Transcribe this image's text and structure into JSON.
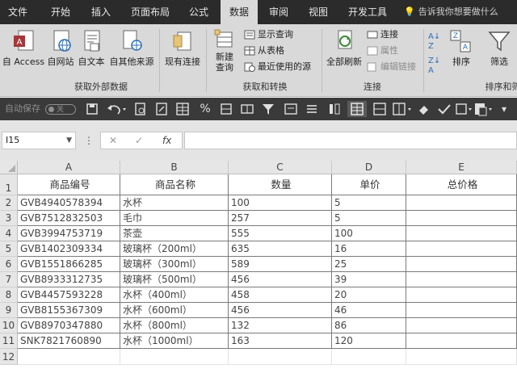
{
  "tabs": [
    "文件",
    "开始",
    "插入",
    "页面布局",
    "公式",
    "数据",
    "审阅",
    "视图",
    "开发工具"
  ],
  "active_tab": "数据",
  "tell_me": "告诉我你想要做什么",
  "ribbon": {
    "get_external": {
      "label": "获取外部数据",
      "buttons": [
        "自 Access",
        "自网站",
        "自文本",
        "自其他来源",
        "现有连接"
      ]
    },
    "get_transform": {
      "label": "获取和转换",
      "new_query": "新建\n查询",
      "small": [
        "显示查询",
        "从表格",
        "最近使用的源"
      ]
    },
    "connections": {
      "label": "连接",
      "refresh_all": "全部刷新",
      "small": [
        "连接",
        "属性",
        "编辑链接"
      ]
    },
    "sort_filter": {
      "label": "排序和筛选",
      "sort": "排序",
      "filter": "筛选"
    }
  },
  "qat": {
    "autosave": "自动保存",
    "toggle": "关"
  },
  "formula_bar": {
    "name_box": "I15",
    "fx": "fx",
    "value": ""
  },
  "sheet": {
    "columns": [
      "A",
      "B",
      "C",
      "D",
      "E"
    ],
    "row_numbers": [
      "1",
      "2",
      "3",
      "4",
      "5",
      "6",
      "7",
      "8",
      "9",
      "10",
      "11",
      "12"
    ],
    "headers": [
      "商品编号",
      "商品名称",
      "数量",
      "单价",
      "总价格"
    ],
    "rows": [
      [
        "GVB4940578394",
        "水杯",
        "100",
        "5",
        ""
      ],
      [
        "GVB7512832503",
        "毛巾",
        "257",
        "5",
        ""
      ],
      [
        "GVB3994753719",
        "茶壶",
        "555",
        "100",
        ""
      ],
      [
        "GVB1402309334",
        "玻璃杯（200ml）",
        "635",
        "16",
        ""
      ],
      [
        "GVB1551866285",
        "玻璃杯（300ml）",
        "589",
        "25",
        ""
      ],
      [
        "GVB8933312735",
        "玻璃杯（500ml）",
        "456",
        "39",
        ""
      ],
      [
        "GVB4457593228",
        "水杯（400ml）",
        "458",
        "20",
        ""
      ],
      [
        "GVB8155367309",
        "水杯（600ml）",
        "456",
        "46",
        ""
      ],
      [
        "GVB8970347880",
        "水杯（800ml）",
        "132",
        "86",
        ""
      ],
      [
        "SNK7821760890",
        "水杯（1000ml）",
        "163",
        "120",
        ""
      ]
    ]
  }
}
